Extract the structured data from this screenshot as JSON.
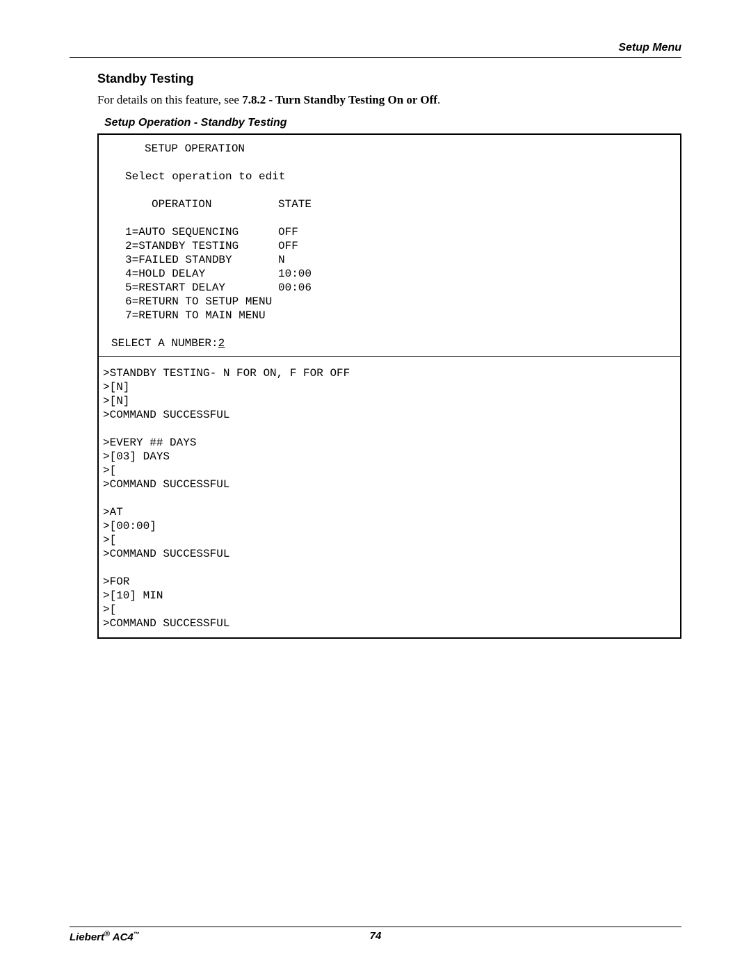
{
  "header": {
    "section_label": "Setup Menu"
  },
  "section": {
    "title": "Standby Testing",
    "intro_prefix": "For details on this feature, see ",
    "intro_bold": "7.8.2 - Turn Standby Testing On or Off",
    "intro_suffix": "."
  },
  "figure": {
    "caption": "Setup Operation - Standby Testing"
  },
  "terminal": {
    "title": "SETUP OPERATION",
    "subtitle": "Select operation to edit",
    "col_headers": {
      "operation": "OPERATION",
      "state": "STATE"
    },
    "rows": [
      {
        "op": "1=AUTO SEQUENCING",
        "state": "OFF"
      },
      {
        "op": "2=STANDBY TESTING",
        "state": "OFF"
      },
      {
        "op": "3=FAILED STANDBY",
        "state": "N"
      },
      {
        "op": "4=HOLD DELAY",
        "state": "10:00"
      },
      {
        "op": "5=RESTART DELAY",
        "state": "00:06"
      },
      {
        "op": "6=RETURN TO SETUP MENU",
        "state": ""
      },
      {
        "op": "7=RETURN TO MAIN MENU",
        "state": ""
      }
    ],
    "select_label": "SELECT A NUMBER:",
    "select_value": "2",
    "session": ">STANDBY TESTING- N FOR ON, F FOR OFF\n>[N]\n>[N]\n>COMMAND SUCCESSFUL\n\n>EVERY ## DAYS\n>[03] DAYS\n>[\n>COMMAND SUCCESSFUL\n\n>AT\n>[00:00]\n>[\n>COMMAND SUCCESSFUL\n\n>FOR\n>[10] MIN\n>[\n>COMMAND SUCCESSFUL"
  },
  "footer": {
    "brand": "Liebert",
    "model": "AC4",
    "page_number": "74"
  }
}
